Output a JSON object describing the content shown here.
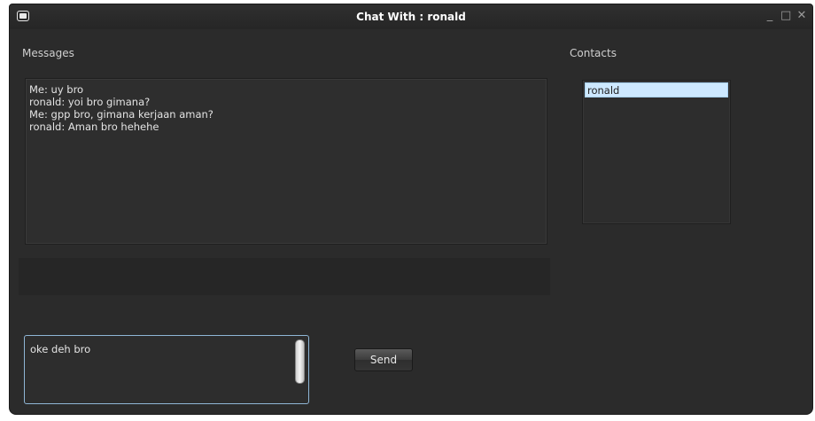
{
  "window": {
    "title": "Chat With : ronald",
    "controls": {
      "minimize": "_",
      "maximize": "□",
      "close": "✕"
    }
  },
  "messages": {
    "label": "Messages",
    "lines": [
      "Me: uy bro",
      "ronald: yoi bro gimana?",
      "Me: gpp bro, gimana kerjaan aman?",
      "ronald: Aman bro hehehe"
    ]
  },
  "contacts": {
    "label": "Contacts",
    "items": [
      "ronald"
    ],
    "selected": "ronald"
  },
  "compose": {
    "value": "oke deh bro",
    "send_label": "Send"
  },
  "colors": {
    "background": "#2b2b2b",
    "selection": "#cde8ff",
    "input_focus_border": "#8fb6d6"
  }
}
